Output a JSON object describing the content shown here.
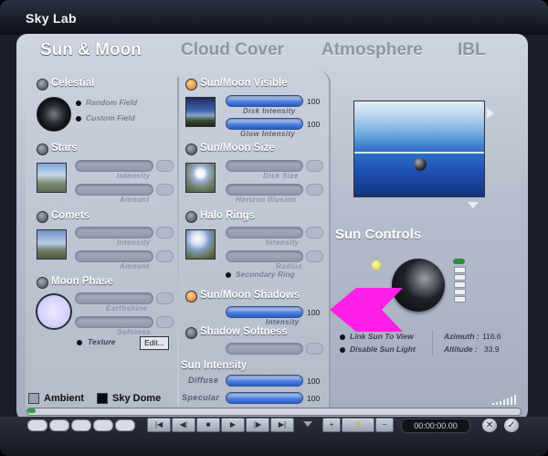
{
  "window": {
    "title": "Sky Lab"
  },
  "tabs": [
    {
      "label": "Sun & Moon",
      "active": true
    },
    {
      "label": "Cloud Cover",
      "active": false
    },
    {
      "label": "Atmosphere",
      "active": false
    },
    {
      "label": "IBL",
      "active": false
    }
  ],
  "celestial": {
    "title": "Celestial",
    "options": [
      "Random Field",
      "Custom Field"
    ]
  },
  "stars": {
    "title": "Stars",
    "sliders": [
      "Intensity",
      "Amount"
    ]
  },
  "comets": {
    "title": "Comets",
    "sliders": [
      "Intensity",
      "Amount"
    ]
  },
  "moon_phase": {
    "title": "Moon Phase",
    "sliders": [
      "Earthshine",
      "Softness"
    ],
    "texture_label": "Texture",
    "edit_button": "Edit..."
  },
  "sun_moon_visible": {
    "title": "Sun/Moon Visible",
    "sliders": [
      {
        "label": "Disk Intensity",
        "value": "100"
      },
      {
        "label": "Glow Intensity",
        "value": "100"
      }
    ]
  },
  "sun_moon_size": {
    "title": "Sun/Moon Size",
    "sliders": [
      "Disk Size",
      "Horizon Illusion"
    ]
  },
  "halo_rings": {
    "title": "Halo Rings",
    "sliders": [
      "Intensity",
      "Radius"
    ],
    "secondary_ring": "Secondary Ring"
  },
  "sun_moon_shadows": {
    "title": "Sun/Moon Shadows",
    "slider": {
      "label": "Intensity",
      "value": "100"
    }
  },
  "shadow_softness": {
    "title": "Shadow Softness"
  },
  "sun_intensity": {
    "title": "Sun Intensity",
    "rows": [
      {
        "label": "Diffuse",
        "value": "100"
      },
      {
        "label": "Specular",
        "value": "100"
      }
    ]
  },
  "sun_controls": {
    "title": "Sun Controls",
    "options": [
      "Link Sun To View",
      "Disable Sun Light"
    ],
    "azimuth_label": "Azimuth :",
    "azimuth_value": "116.6",
    "altitude_label": "Altitude :",
    "altitude_value": "33.9"
  },
  "bottom": {
    "ambient": "Ambient",
    "sky_dome": "Sky Dome",
    "timecode": "00:00:00.00"
  },
  "colors": {
    "accent_blue": "#3f78dc",
    "arrow_magenta": "#ff1fe6",
    "orange_indicator": "#e08a2a"
  }
}
